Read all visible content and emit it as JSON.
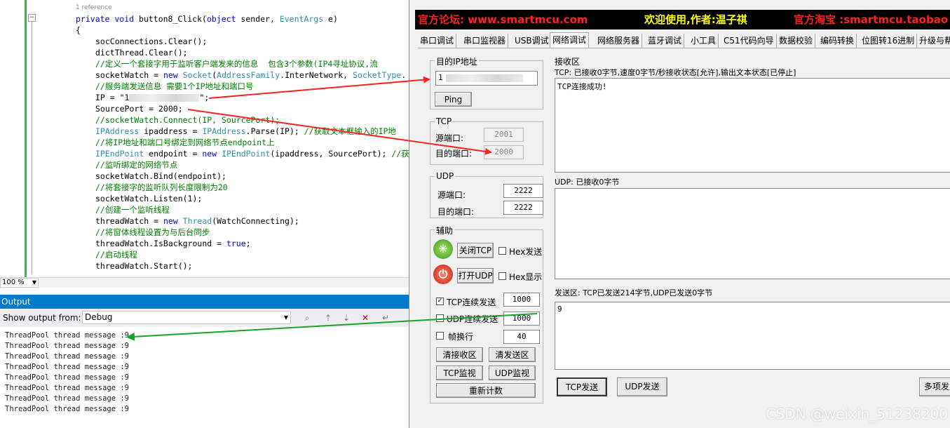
{
  "editor": {
    "refs": "1 reference",
    "zoom": "100 %",
    "lines": {
      "sig": "private void button8_Click(object sender, EventArgs e)",
      "open": "{",
      "l1": "socConnections.Clear();",
      "l2": "dictThread.Clear();",
      "l3": "//定义一个套接字用于监听客户端发来的信息  包含3个参数(IP4寻址协议,流",
      "l4": "socketWatch = new Socket(AddressFamily.InterNetwork, SocketType.",
      "l5": "//服务端发送信息 需要1个IP地址和端口号",
      "l6a": "IP = \"1",
      "l6b": "\";",
      "l7": "SourcePort = 2000;",
      "l8": "//socketWatch.Connect(IP, SourcePort);",
      "l9": "IPAddress ipaddress = IPAddress.Parse(IP); //获取文本框输入的IP地",
      "l10": "//将IP地址和端口号绑定到网络节点endpoint上",
      "l11": "IPEndPoint endpoint = new IPEndPoint(ipaddress, SourcePort); //获",
      "l12": "//监听绑定的网络节点",
      "l13": "socketWatch.Bind(endpoint);",
      "l14": "//将套接字的监听队列长度限制为20",
      "l15": "socketWatch.Listen(1);",
      "l16": "//创建一个监听线程",
      "l17": "threadWatch = new Thread(WatchConnecting);",
      "l18": "//将窗体线程设置为与后台同步",
      "l19": "threadWatch.IsBackground = true;",
      "l20": "//启动线程",
      "l21": "threadWatch.Start();"
    }
  },
  "output": {
    "title": "Output",
    "show_from_label": "Show output from:",
    "source": "Debug",
    "lines": [
      "ThreadPool thread message :9",
      "ThreadPool thread message :9",
      "ThreadPool thread message :9",
      "ThreadPool thread message :9",
      "ThreadPool thread message :9",
      "ThreadPool thread message :9",
      "ThreadPool thread message :9",
      "ThreadPool thread message :9"
    ]
  },
  "tool": {
    "banner": {
      "forum": "官方论坛: www.smartmcu.com",
      "welcome": "欢迎使用,作者:温子祺",
      "shop": "官方淘宝 :smartmcu.taobao"
    },
    "tabs": [
      "串口调试",
      "串口监视器",
      "USB调试",
      "网络调试",
      "网络服务器",
      "蓝牙调试",
      "小工具",
      "C51代码向导",
      "数据校验",
      "编码转换",
      "位图转16进制",
      "升级与帮"
    ],
    "active_tab": "网络调试",
    "ip_group": {
      "title": "目的IP地址",
      "ip_value": "1",
      "ping": "Ping"
    },
    "tcp_group": {
      "title": "TCP",
      "src_label": "源端口:",
      "src_value": "2001",
      "dst_label": "目的端口:",
      "dst_value": "2000"
    },
    "udp_group": {
      "title": "UDP",
      "src_label": "源端口:",
      "src_value": "2222",
      "dst_label": "目的端口:",
      "dst_value": "2222"
    },
    "aux_group": {
      "title": "辅助",
      "close_tcp": "关闭TCP",
      "open_udp": "打开UDP",
      "hex_send": "Hex发送",
      "hex_show": "Hex显示",
      "tcp_cont": "TCP连续发送",
      "tcp_cont_val": "1000",
      "udp_cont": "UDP连续发送",
      "udp_cont_val": "1000",
      "frame_nl": "帧换行",
      "frame_val": "40",
      "clear_recv": "清接收区",
      "clear_send": "清发送区",
      "tcp_mon": "TCP监视",
      "udp_mon": "UDP监视",
      "recount": "重新计数"
    },
    "recv": {
      "title": "接收区",
      "tcp_status": "TCP: 已接收0字节,速度0字节/秒接收状态[允许],输出文本状态[已停止]",
      "tcp_text": "TCP连接成功!",
      "udp_status": "UDP: 已接收0字节"
    },
    "send": {
      "title": "发送区: TCP已发送214字节,UDP已发送0字节",
      "text": "9",
      "tcp_send": "TCP发送",
      "udp_send": "UDP发送",
      "multi_send": "多项发"
    }
  },
  "watermark": "CSDN @weixin_51238200",
  "colors": {
    "arrow_red": "#ff2020",
    "arrow_green": "#1aa32a",
    "vs_blue": "#007acc"
  }
}
